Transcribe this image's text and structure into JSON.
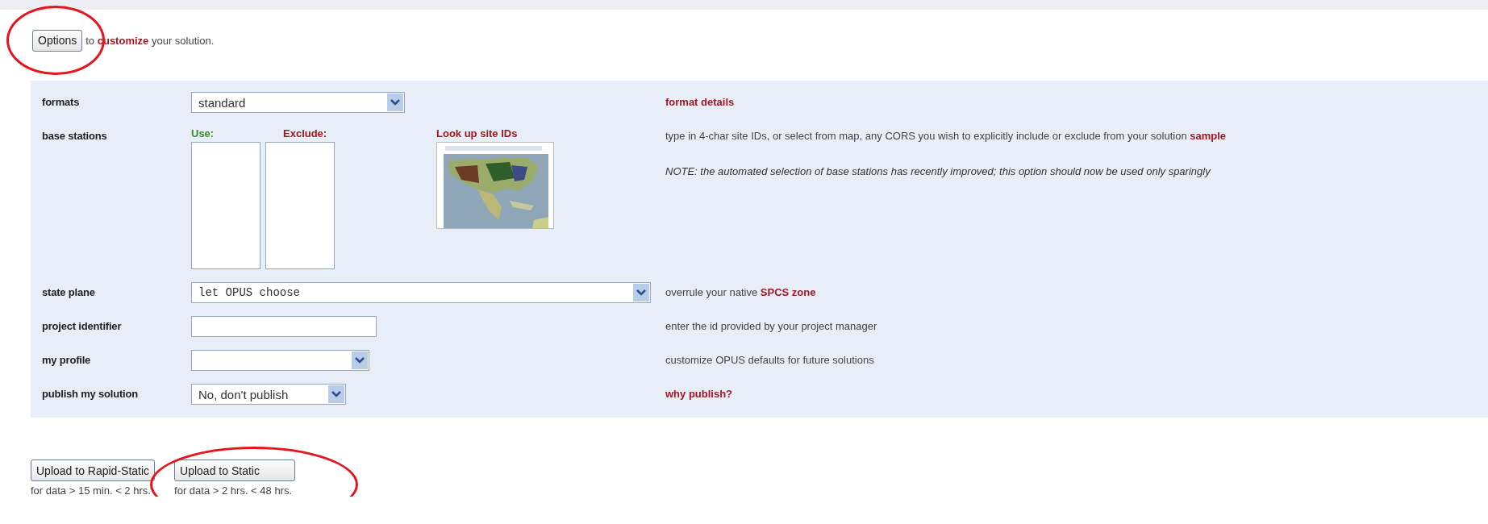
{
  "intro": {
    "button": "Options",
    "circled": true,
    "prefix": "to",
    "link": "customize",
    "suffix": "your solution."
  },
  "rows": [
    {
      "kind": "select",
      "label": "formats",
      "value": "standard",
      "help": {
        "link": "format details"
      }
    },
    {
      "kind": "stations",
      "label": "base stations",
      "use_label": "Use:",
      "exclude_label": "Exclude:",
      "lookup_link": "Look up site IDs",
      "help": {
        "text": "type in 4-char site IDs, or select from map, any CORS you wish to explicitly include or exclude from your solution",
        "link": "sample",
        "note": "NOTE: the automated selection of base stations has recently improved; this option should now be used only sparingly"
      }
    },
    {
      "kind": "select",
      "label": "state plane",
      "value": "let OPUS choose",
      "help": {
        "text": "overrule your native",
        "link": "SPCS zone"
      }
    },
    {
      "kind": "input",
      "label": "project identifier",
      "help": {
        "text": "enter the id provided by your project manager"
      }
    },
    {
      "kind": "select",
      "label": "my profile",
      "help": {
        "text": "customize OPUS defaults for future solutions"
      }
    },
    {
      "kind": "select",
      "label": "publish my solution",
      "value": "No, don't publish",
      "help": {
        "link": "why publish?"
      }
    }
  ],
  "uploads": [
    {
      "label": "Upload to Rapid-Static",
      "caption": "for data > 15 min. < 2 hrs.",
      "circled": false
    },
    {
      "label": "Upload to Static",
      "caption": "for data > 2 hrs. < 48 hrs.",
      "circled": true
    }
  ]
}
